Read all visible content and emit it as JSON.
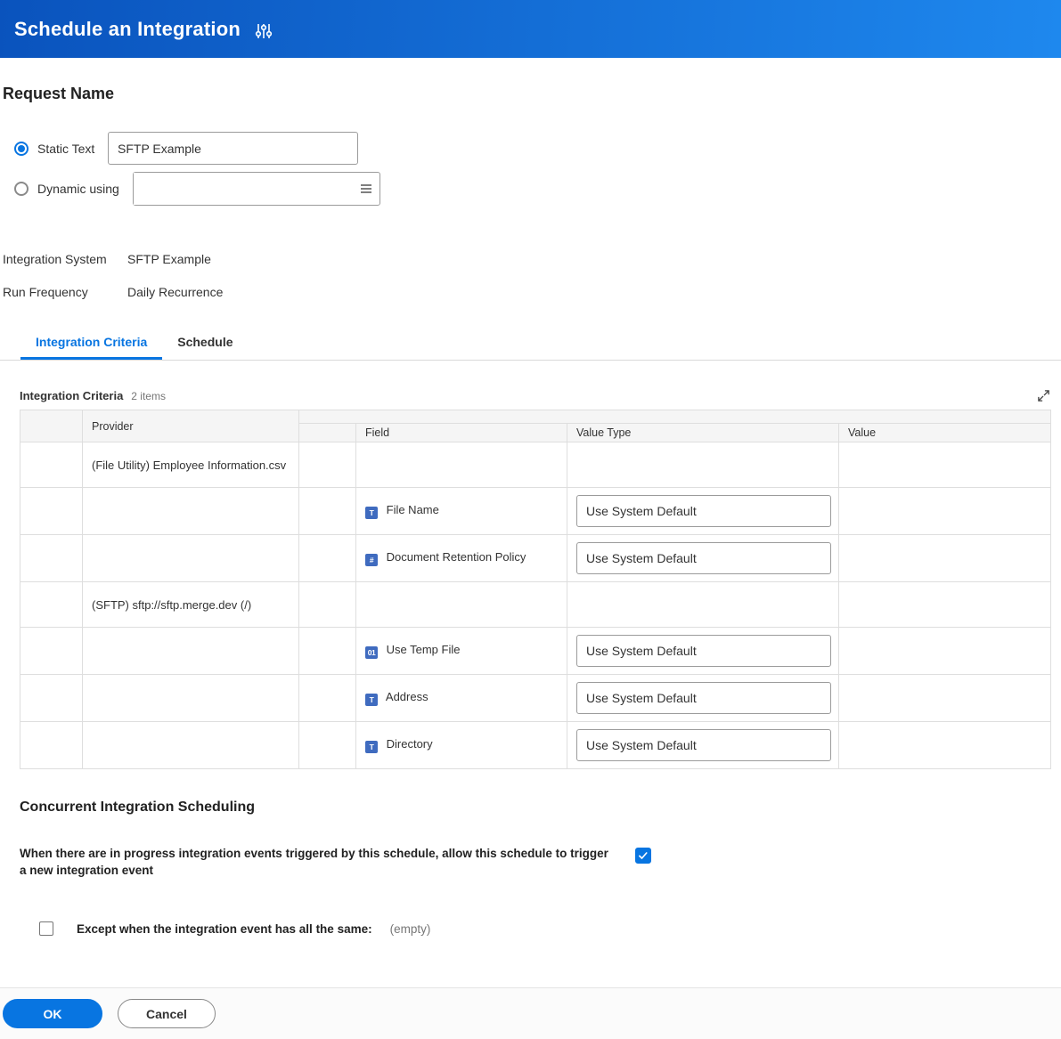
{
  "colors": {
    "accent": "#0875e1",
    "header_gradient_start": "#0a53bd",
    "header_gradient_end": "#1e88ee"
  },
  "header": {
    "title": "Schedule an Integration"
  },
  "request_name": {
    "heading": "Request Name",
    "static_option": {
      "label": "Static Text",
      "value": "SFTP Example",
      "selected": true
    },
    "dynamic_option": {
      "label": "Dynamic using",
      "value": "",
      "selected": false
    }
  },
  "summary_fields": [
    {
      "label": "Integration System",
      "value": "SFTP Example"
    },
    {
      "label": "Run Frequency",
      "value": "Daily Recurrence"
    }
  ],
  "tabs": [
    {
      "label": "Integration Criteria",
      "active": true
    },
    {
      "label": "Schedule",
      "active": false
    }
  ],
  "criteria_table": {
    "title": "Integration Criteria",
    "count": "2 items",
    "outer_headers": {
      "provider": "Provider"
    },
    "inner_headers": {
      "field": "Field",
      "value_type": "Value Type",
      "value": "Value"
    },
    "rows": [
      {
        "type": "provider",
        "provider": "(File Utility) Employee Information.csv"
      },
      {
        "type": "field",
        "icon": "T",
        "field": "File Name",
        "value_type": "Use System Default",
        "value": ""
      },
      {
        "type": "field",
        "icon": "#",
        "field": "Document Retention Policy",
        "value_type": "Use System Default",
        "value": ""
      },
      {
        "type": "provider",
        "provider": "(SFTP) sftp://sftp.merge.dev (/)"
      },
      {
        "type": "field",
        "icon": "01",
        "field": "Use Temp File",
        "value_type": "Use System Default",
        "value": ""
      },
      {
        "type": "field",
        "icon": "T",
        "field": "Address",
        "value_type": "Use System Default",
        "value": ""
      },
      {
        "type": "field",
        "icon": "T",
        "field": "Directory",
        "value_type": "Use System Default",
        "value": ""
      }
    ]
  },
  "concurrent": {
    "heading": "Concurrent Integration Scheduling",
    "allow_label": "When there are in progress integration events triggered by this schedule, allow this schedule to trigger a new integration event",
    "allow_checked": true,
    "except_label": "Except when the integration event has all the same:",
    "except_checked": false,
    "except_value": "(empty)"
  },
  "footer": {
    "ok_label": "OK",
    "cancel_label": "Cancel"
  }
}
